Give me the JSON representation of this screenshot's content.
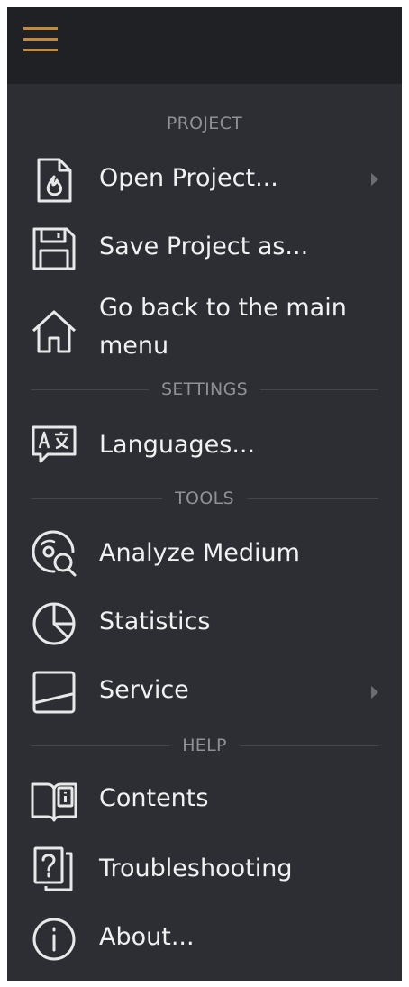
{
  "header": {
    "menu_icon": "hamburger-icon",
    "accent_color": "#c48a3a"
  },
  "sections": {
    "project": "PROJECT",
    "settings": "SETTINGS",
    "tools": "TOOLS",
    "help": "HELP"
  },
  "items": {
    "open_project": {
      "label": "Open Project...",
      "icon": "document-flame-icon",
      "has_submenu": true
    },
    "save_project": {
      "label": "Save Project as...",
      "icon": "floppy-disk-icon"
    },
    "main_menu": {
      "label_line1": "Go back to the main",
      "label_line2": "menu",
      "icon": "home-icon"
    },
    "languages": {
      "label": "Languages...",
      "icon": "translate-icon"
    },
    "analyze": {
      "label": "Analyze Medium",
      "icon": "disc-magnifier-icon"
    },
    "statistics": {
      "label": "Statistics",
      "icon": "pie-chart-icon"
    },
    "service": {
      "label": "Service",
      "icon": "service-window-icon",
      "has_submenu": true
    },
    "contents": {
      "label": "Contents",
      "icon": "book-info-icon"
    },
    "troubleshooting": {
      "label": "Troubleshooting",
      "icon": "question-pages-icon"
    },
    "about": {
      "label": "About...",
      "icon": "info-circle-icon"
    }
  },
  "colors": {
    "panel_bg": "#2d2e33",
    "header_bg": "#202124",
    "text": "#f1f1f1",
    "section_text": "#8f9196"
  }
}
